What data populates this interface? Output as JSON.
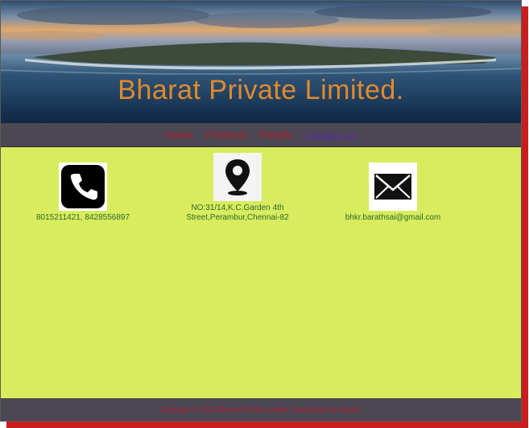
{
  "header": {
    "title": "Bharat Private Limited."
  },
  "nav": {
    "items": [
      {
        "label": "Home"
      },
      {
        "label": "Products"
      },
      {
        "label": "People"
      },
      {
        "label": "Contact Us"
      }
    ],
    "active_index": 3
  },
  "contacts": {
    "phone": {
      "icon": "phone-icon",
      "text": "8015211421, 8428556897"
    },
    "address": {
      "icon": "location-pin-icon",
      "line1": "NO:31/14,K.C.Garden 4th",
      "line2": "Street,Perambur,Chennai-82"
    },
    "email": {
      "icon": "envelope-icon",
      "text": "bhkr.barathsai@gmail.com"
    }
  },
  "footer": {
    "text": "Copyright © 2021 Bharat Private Limited. Developed by Barath."
  },
  "colors": {
    "banner_title": "#e08a2c",
    "nav_bg": "#4b4854",
    "nav_link": "#b51f2a",
    "nav_active": "#5b2a9a",
    "content_bg": "#d8ec5e",
    "contact_text": "#2c6a2c",
    "shadow": "#c81e1e"
  }
}
